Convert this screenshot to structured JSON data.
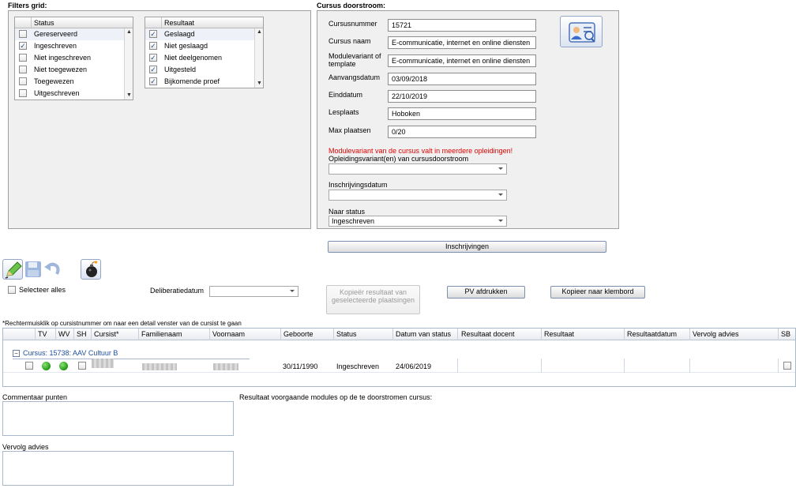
{
  "filters": {
    "title": "Filters grid:",
    "status": {
      "header": "Status",
      "items": [
        {
          "label": "Gereserveerd",
          "checked": false
        },
        {
          "label": "Ingeschreven",
          "checked": true
        },
        {
          "label": "Niet ingeschreven",
          "checked": false
        },
        {
          "label": "Niet toegewezen",
          "checked": false
        },
        {
          "label": "Toegewezen",
          "checked": false
        },
        {
          "label": "Uitgeschreven",
          "checked": false
        }
      ]
    },
    "resultaat": {
      "header": "Resultaat",
      "items": [
        {
          "label": "Geslaagd",
          "checked": true
        },
        {
          "label": "Niet geslaagd",
          "checked": true
        },
        {
          "label": "Niet deelgenomen",
          "checked": true
        },
        {
          "label": "Uitgesteld",
          "checked": true
        },
        {
          "label": "Bijkomende proef",
          "checked": true
        }
      ]
    }
  },
  "course": {
    "title": "Cursus doorstroom:",
    "fields": {
      "cursusnummer_label": "Cursusnummer",
      "cursusnummer": "15721",
      "cursusnaam_label": "Cursus naam",
      "cursusnaam": "E-communicatie, internet en online diensten",
      "modulevariant_label": "Modulevariant of template",
      "modulevariant": "E-communicatie, internet en online diensten",
      "aanvangsdatum_label": "Aanvangsdatum",
      "aanvangsdatum": "03/09/2018",
      "einddatum_label": "Einddatum",
      "einddatum": "22/10/2019",
      "lesplaats_label": "Lesplaats",
      "lesplaats": "Hoboken",
      "max_label": "Max plaatsen",
      "max": "0/20"
    },
    "warning": "Modulevariant van de cursus valt in meerdere opleidingen!",
    "opleiding_label": "Opleidingsvariant(en) van cursusdoorstroom",
    "opleiding_value": "",
    "inschrijvingsdatum_label": "Inschrijvingsdatum",
    "inschrijvingsdatum_value": "",
    "naar_status_label": "Naar status",
    "naar_status_value": "Ingeschreven",
    "inschrijvingen_button": "Inschrijvingen"
  },
  "toolbar": {
    "select_all": "Selecteer alles",
    "deliberatie_label": "Deliberatiedatum",
    "deliberatie_value": "",
    "copy_result_button": "Kopieër resultaat van geselecteerde plaatsingen",
    "pv_button": "PV afdrukken",
    "clipboard_button": "Kopieer naar klembord"
  },
  "grid": {
    "hint": "*Rechtermuisklik op cursistnummer om naar een detail venster van de cursist te gaan",
    "columns": [
      "TV",
      "WV",
      "SH",
      "Cursist*",
      "Familienaam",
      "Voornaam",
      "Geboorte",
      "Status",
      "Datum van status",
      "Resultaat docent",
      "Resultaat",
      "Resultaatdatum",
      "Vervolg advies",
      "SB"
    ],
    "group_label": "Cursus: 15738: AAV Cultuur B",
    "rows": [
      {
        "geboorte": "30/11/1990",
        "status": "Ingeschreven",
        "datum_status": "24/06/2019"
      }
    ]
  },
  "bottom": {
    "commentaar_label": "Commentaar punten",
    "vervolg_label": "Vervolg advies",
    "resultaat_label": "Resultaat voorgaande modules op de te doorstromen cursus:"
  },
  "colors": {
    "warning": "#e00000",
    "group_link": "#1f4fa0",
    "accent_border": "#7d8fb0"
  }
}
